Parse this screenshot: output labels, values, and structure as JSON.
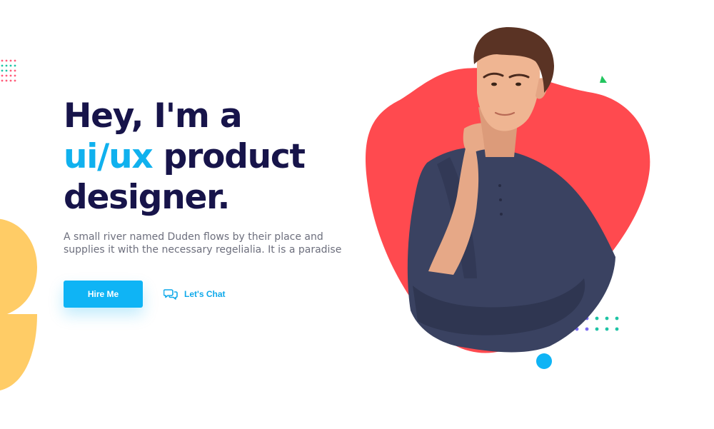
{
  "hero": {
    "headline_line1": "Hey, I'm a",
    "headline_accent": "ui/ux",
    "headline_line2_rest": " product",
    "headline_line3": "designer.",
    "description": "A small river named Duden flows by their place and supplies it with the necessary regelialia. It is a paradise"
  },
  "actions": {
    "hire_label": "Hire Me",
    "chat_label": "Let's Chat",
    "chat_icon": "chat-bubbles-icon"
  },
  "colors": {
    "navy": "#17144a",
    "accent_blue": "#10b1ee",
    "coral": "#ff4a4f",
    "yellow": "#ffcc66",
    "shirt": "#3a4261"
  }
}
